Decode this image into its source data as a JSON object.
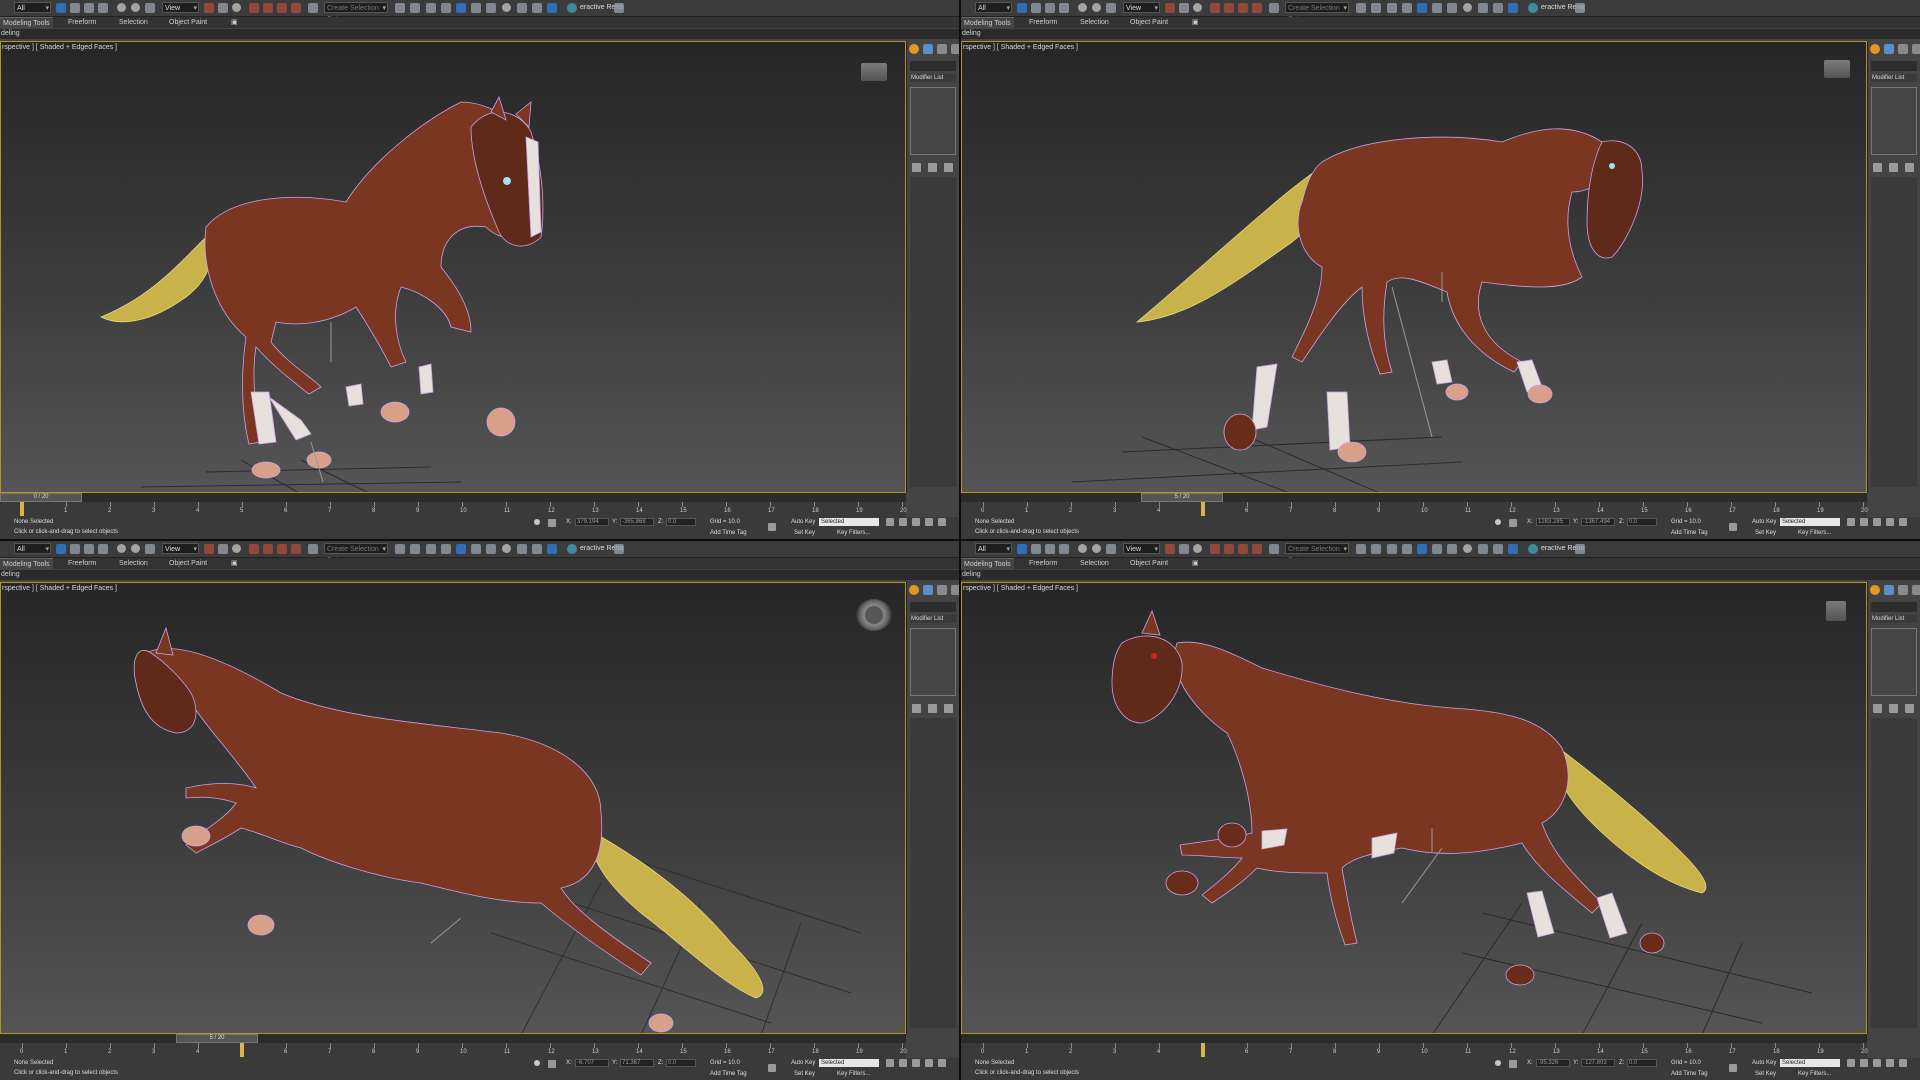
{
  "toolbar": {
    "selection_filter": "All",
    "ref_coord_system": "View",
    "named_selection": "Create Selection Set",
    "interactive_label": "eractive Rena"
  },
  "ribbon": {
    "tabs": [
      "Modeling Tools",
      "Freeform",
      "Selection",
      "Object Paint"
    ],
    "sub_label": "deling"
  },
  "viewport": {
    "label": "rspective ] [ Shaded + Edged Faces ]",
    "colors": {
      "frame": "#b6951e",
      "horse_body": "#7a3621",
      "wireframe": "#c9a3ea",
      "tail": "#c9b24a",
      "socks": "#e6e1dc"
    }
  },
  "command_panel": {
    "modifier_list": "Modifier List"
  },
  "status": {
    "selection": "None Selected",
    "prompt": "Click or click-and-drag to select objects",
    "grid": "Grid = 10.0",
    "auto_key": "Auto Key",
    "set_key": "Set Key",
    "key_mode": "Selected",
    "key_filters": "Key Filters...",
    "add_time_tag": "Add Time Tag",
    "z_label": "Z:"
  },
  "panes": [
    {
      "frame_label": "0 / 20",
      "current_frame": 0,
      "x": "379.194",
      "y": "-365.868",
      "z": "0.0"
    },
    {
      "frame_label": "5 / 20",
      "current_frame": 5,
      "x": "1283.285",
      "y": "-1367.494",
      "z": "0.0"
    },
    {
      "frame_label": "5 / 20",
      "current_frame": 5,
      "x": "-6.707",
      "y": "71.367",
      "z": "0.0"
    },
    {
      "frame_label": "5 / 20",
      "current_frame": 5,
      "x": "-95.326",
      "y": "-127.803",
      "z": "0.0"
    }
  ],
  "timeline": {
    "ticks": [
      0,
      1,
      2,
      3,
      4,
      5,
      6,
      7,
      8,
      9,
      10,
      11,
      12,
      13,
      14,
      15,
      16,
      17,
      18,
      19,
      20
    ]
  }
}
